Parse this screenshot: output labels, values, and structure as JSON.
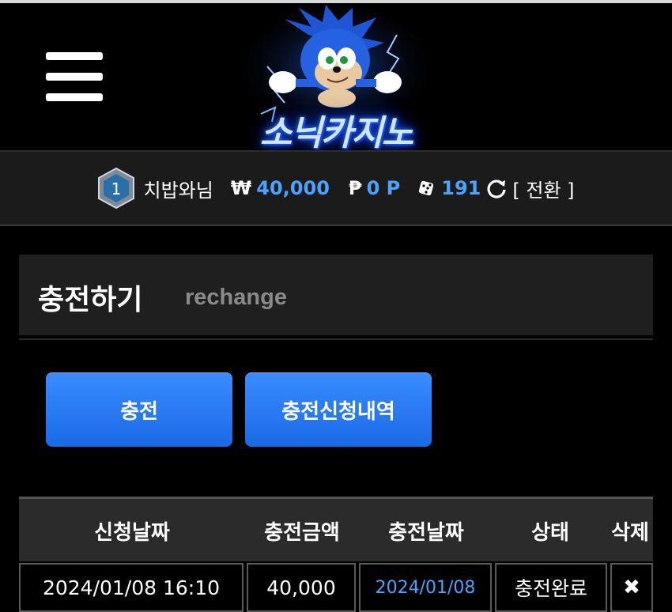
{
  "header": {
    "logo_text": "소닉카지노"
  },
  "user_bar": {
    "level": "1",
    "username": "치밥와님",
    "money_symbol": "₩",
    "money": "40,000",
    "point_symbol": "₱",
    "point": "0 P",
    "chips": "191",
    "convert_label": "[ 전환 ]"
  },
  "section": {
    "title_ko": "충전하기",
    "title_en": "rechange"
  },
  "buttons": {
    "charge": "충전",
    "history": "충전신청내역"
  },
  "table": {
    "columns": [
      "신청날짜",
      "충전금액",
      "충전날짜",
      "상태",
      "삭제"
    ],
    "rows": [
      {
        "request_date": "2024/01/08 16:10",
        "amount": "40,000",
        "charge_date": "2024/01/08",
        "status": "충전완료",
        "delete": "✖"
      }
    ]
  },
  "colors": {
    "accent": "#4aa3ff",
    "button": "#2a7cf5",
    "background": "#000000"
  }
}
